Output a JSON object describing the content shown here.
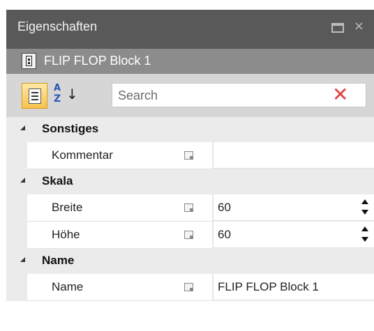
{
  "panel": {
    "title": "Eigenschaften",
    "title_buttons": [
      "restore-icon",
      "close-icon"
    ],
    "close_glyph": "×"
  },
  "object": {
    "icon": "flipflop-block-icon",
    "name": "FLIP FLOP Block 1"
  },
  "toolbar": {
    "categorized_icon": "categorized-view-icon",
    "alphabetical_icon": "sort-alphabetical-icon",
    "alpha_top": "A",
    "alpha_bottom": "Z",
    "alpha_arrow": "↓",
    "search_placeholder": "Search",
    "clear_glyph": "✕",
    "clear_icon": "clear-search-icon"
  },
  "categories": [
    {
      "label": "Sonstiges",
      "properties": [
        {
          "name": "Kommentar",
          "value": "",
          "spinner": false
        }
      ]
    },
    {
      "label": "Skala",
      "properties": [
        {
          "name": "Breite",
          "value": "60",
          "spinner": true
        },
        {
          "name": "Höhe",
          "value": "60",
          "spinner": true
        }
      ]
    },
    {
      "label": "Name",
      "properties": [
        {
          "name": "Name",
          "value": "FLIP FLOP Block 1",
          "spinner": false
        }
      ]
    }
  ],
  "colors": {
    "titlebar": "#595959",
    "object_bar": "#8c8c8c",
    "toolbar": "#d6d6d6",
    "active_button": "#f7c24b",
    "clear_icon": "#e04040",
    "grid_gutter": "#ebebeb"
  }
}
